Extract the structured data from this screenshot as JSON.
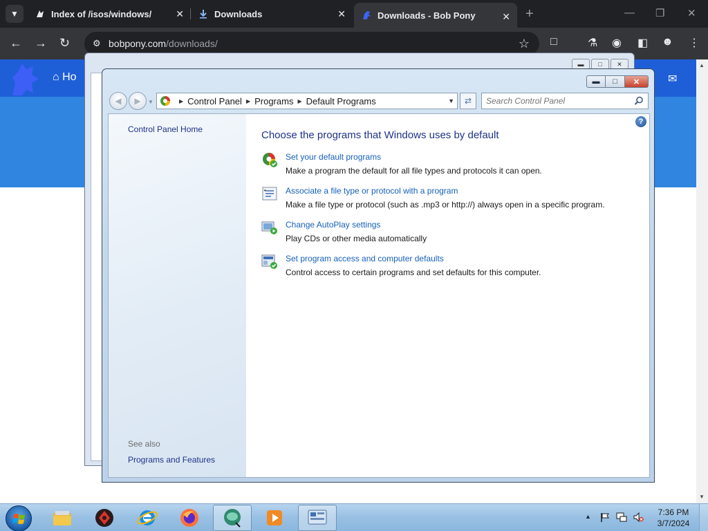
{
  "browser": {
    "tabs": [
      {
        "title": "Index of /isos/windows/",
        "icon": "github-style-icon"
      },
      {
        "title": "Downloads",
        "icon": "download-icon"
      },
      {
        "title": "Downloads - Bob Pony",
        "icon": "bobpony-logo-icon"
      }
    ],
    "url_host": "bobpony.com",
    "url_path": "/downloads/"
  },
  "site": {
    "home_label": "Ho"
  },
  "control_panel": {
    "breadcrumb": [
      "Control Panel",
      "Programs",
      "Default Programs"
    ],
    "search_placeholder": "Search Control Panel",
    "sidebar_home": "Control Panel Home",
    "see_also": "See also",
    "see_also_link": "Programs and Features",
    "title": "Choose the programs that Windows uses by default",
    "tasks": [
      {
        "link": "Set your default programs",
        "desc": "Make a program the default for all file types and protocols it can open.",
        "icon": "default-programs-icon"
      },
      {
        "link": "Associate a file type or protocol with a program",
        "desc": "Make a file type or protocol (such as .mp3 or http://) always open in a specific program.",
        "icon": "file-association-icon"
      },
      {
        "link": "Change AutoPlay settings",
        "desc": "Play CDs or other media automatically",
        "icon": "autoplay-icon"
      },
      {
        "link": "Set program access and computer defaults",
        "desc": "Control access to certain programs and set defaults for this computer.",
        "icon": "program-access-icon"
      }
    ]
  },
  "taskbar": {
    "apps": [
      "windows-explorer-icon",
      "app-red-icon",
      "internet-explorer-icon",
      "firefox-icon",
      "generic-app-icon",
      "media-player-icon",
      "control-panel-icon"
    ],
    "clock_time": "7:36 PM",
    "clock_date": "3/7/2024"
  },
  "colors": {
    "chrome_dark": "#202124",
    "chrome_toolbar": "#35363a",
    "site_blue": "#2f85e0",
    "link_blue": "#1660b8",
    "heading_blue": "#1e3287",
    "taskbar": "#98c0e3"
  }
}
